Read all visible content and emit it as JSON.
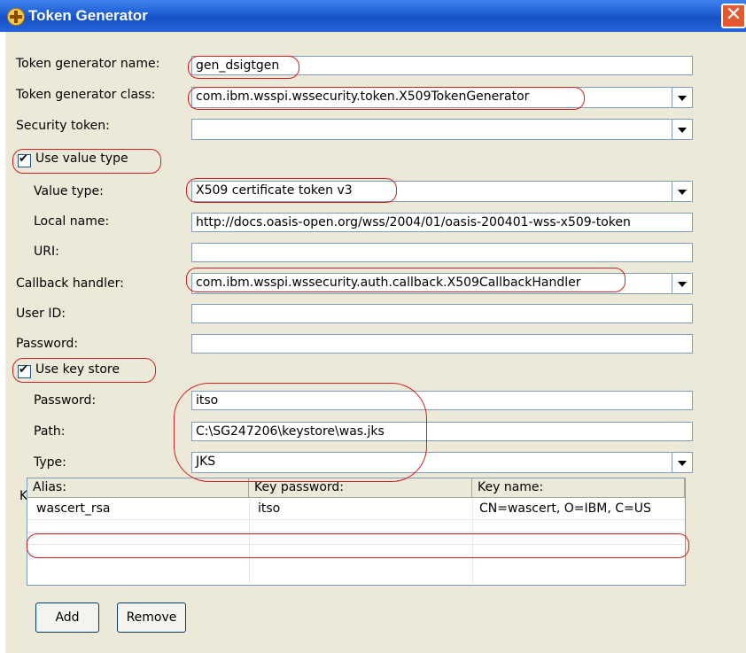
{
  "window": {
    "title": "Token Generator",
    "close_glyph": "✕"
  },
  "form": {
    "generator_name": {
      "label": "Token generator name:",
      "value": "gen_dsigtgen"
    },
    "generator_class": {
      "label": "Token generator class:",
      "value": "com.ibm.wsspi.wssecurity.token.X509TokenGenerator"
    },
    "security_token": {
      "label": "Security token:",
      "value": ""
    },
    "use_value_type": {
      "label": "Use value type",
      "checked": true
    },
    "value_type": {
      "label": "Value type:",
      "value": "X509 certificate token v3"
    },
    "local_name": {
      "label": "Local name:",
      "value": "http://docs.oasis-open.org/wss/2004/01/oasis-200401-wss-x509-token"
    },
    "uri": {
      "label": "URI:",
      "value": ""
    },
    "callback_handler": {
      "label": "Callback handler:",
      "value": "com.ibm.wsspi.wssecurity.auth.callback.X509CallbackHandler"
    },
    "user_id": {
      "label": "User ID:",
      "value": ""
    },
    "password": {
      "label": "Password:",
      "value": ""
    },
    "use_key_store": {
      "label": "Use key store",
      "checked": true
    },
    "ks_password": {
      "label": "Password:",
      "value": "itso"
    },
    "ks_path": {
      "label": "Path:",
      "value": "C:\\SG247206\\keystore\\was.jks"
    },
    "ks_type": {
      "label": "Type:",
      "value": "JKS"
    }
  },
  "key": {
    "label": "Key:",
    "columns": [
      "Alias:",
      "Key password:",
      "Key name:"
    ],
    "rows": [
      [
        "wascert_rsa",
        "itso",
        "CN=wascert, O=IBM, C=US"
      ]
    ]
  },
  "buttons": {
    "add": "Add",
    "remove": "Remove"
  },
  "colors": {
    "titlebar": "#1d5ed5",
    "dialog_bg": "#ece9d8",
    "highlight": "#d02020"
  }
}
